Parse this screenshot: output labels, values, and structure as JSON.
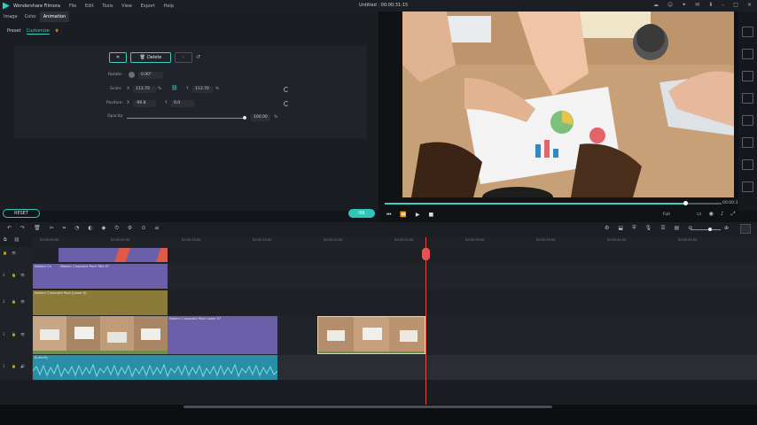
{
  "window": {
    "app_name": "Wondershare Filmora",
    "menu": [
      "File",
      "Edit",
      "Tools",
      "View",
      "Export",
      "Help"
    ],
    "project_title": "Untitled : 00:00:31:15"
  },
  "tabs": [
    "Image",
    "Color",
    "Animation"
  ],
  "active_tab": "Animation",
  "subtabs": [
    "Preset",
    "Customize"
  ],
  "active_subtab": "Customize",
  "keyframe": {
    "delete_label": "Delete",
    "rotate_label": "Rotate:",
    "rotate_value": "0.00°",
    "scale_label": "Scale:",
    "scale_x_label": "X",
    "scale_x": "113.70",
    "scale_x_unit": "%",
    "scale_y_label": "Y",
    "scale_y": "113.70",
    "scale_y_unit": "%",
    "position_label": "Position:",
    "position_x_label": "X",
    "position_x": "-90.8",
    "position_y_label": "Y",
    "position_y": "0.0",
    "opacity_label": "Opacity:",
    "opacity_value": "100.00",
    "opacity_unit": "%"
  },
  "buttons": {
    "reset": "RESET",
    "ok": "OK"
  },
  "player": {
    "timecode": "00:00:31:15",
    "quality": "Full",
    "progress": 0.9
  },
  "ruler_labels": [
    "00:00:00:00",
    "00:00:05:00",
    "00:00:10:00",
    "00:00:15:00",
    "00:00:20:00",
    "00:00:25:00",
    "00:00:30:00",
    "00:00:35:00",
    "00:00:40:00",
    "00:00:45:00"
  ],
  "timeline": {
    "track_numbers": [
      "3",
      "2",
      "1",
      "1"
    ],
    "clips": {
      "title_a": "Modern Co",
      "title_b": "Modern Corporate Pack Title 07",
      "element": "Modern Corporate Pack (Lower 6)",
      "video_lower": "Modern Corporate Pack Lower 07",
      "audio": "Butterfly"
    }
  },
  "colors": {
    "accent": "#2fc6b9",
    "playhead": "#e04a4a",
    "title_clip": "#6a5fa8",
    "element_clip": "#8c7a3a",
    "audio_clip": "#2a8fa6"
  }
}
